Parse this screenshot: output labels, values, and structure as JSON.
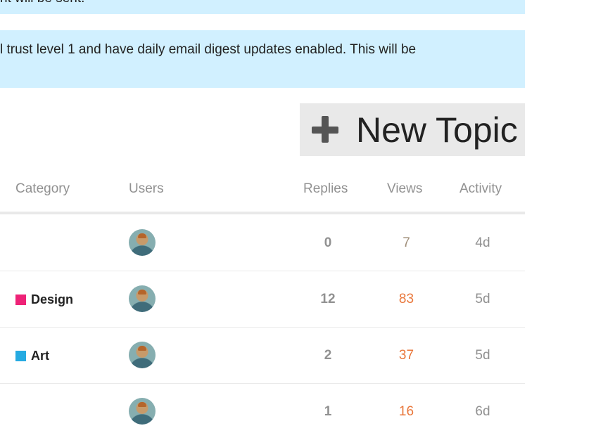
{
  "notices": {
    "top_text": "nt will be sent.",
    "second_text": "l trust level 1 and have daily email digest updates enabled. This will be"
  },
  "toolbar": {
    "new_topic_label": "New Topic",
    "new_topic_icon": "plus-icon"
  },
  "table": {
    "headers": {
      "category": "Category",
      "users": "Users",
      "replies": "Replies",
      "views": "Views",
      "activity": "Activity"
    },
    "rows": [
      {
        "category": "",
        "category_color": "",
        "replies": "0",
        "views": "7",
        "views_state": "normal",
        "activity": "4d"
      },
      {
        "category": "Design",
        "category_color": "#ee2277",
        "replies": "12",
        "views": "83",
        "views_state": "hot",
        "activity": "5d"
      },
      {
        "category": "Art",
        "category_color": "#25aae1",
        "replies": "2",
        "views": "37",
        "views_state": "hot",
        "activity": "5d"
      },
      {
        "category": "",
        "category_color": "",
        "replies": "1",
        "views": "16",
        "views_state": "hot",
        "activity": "6d"
      }
    ]
  },
  "colors": {
    "notice_bg": "#d1f0ff",
    "views_hot": "#e9773b",
    "views_normal": "#a08f7a",
    "muted_text": "#919191"
  }
}
